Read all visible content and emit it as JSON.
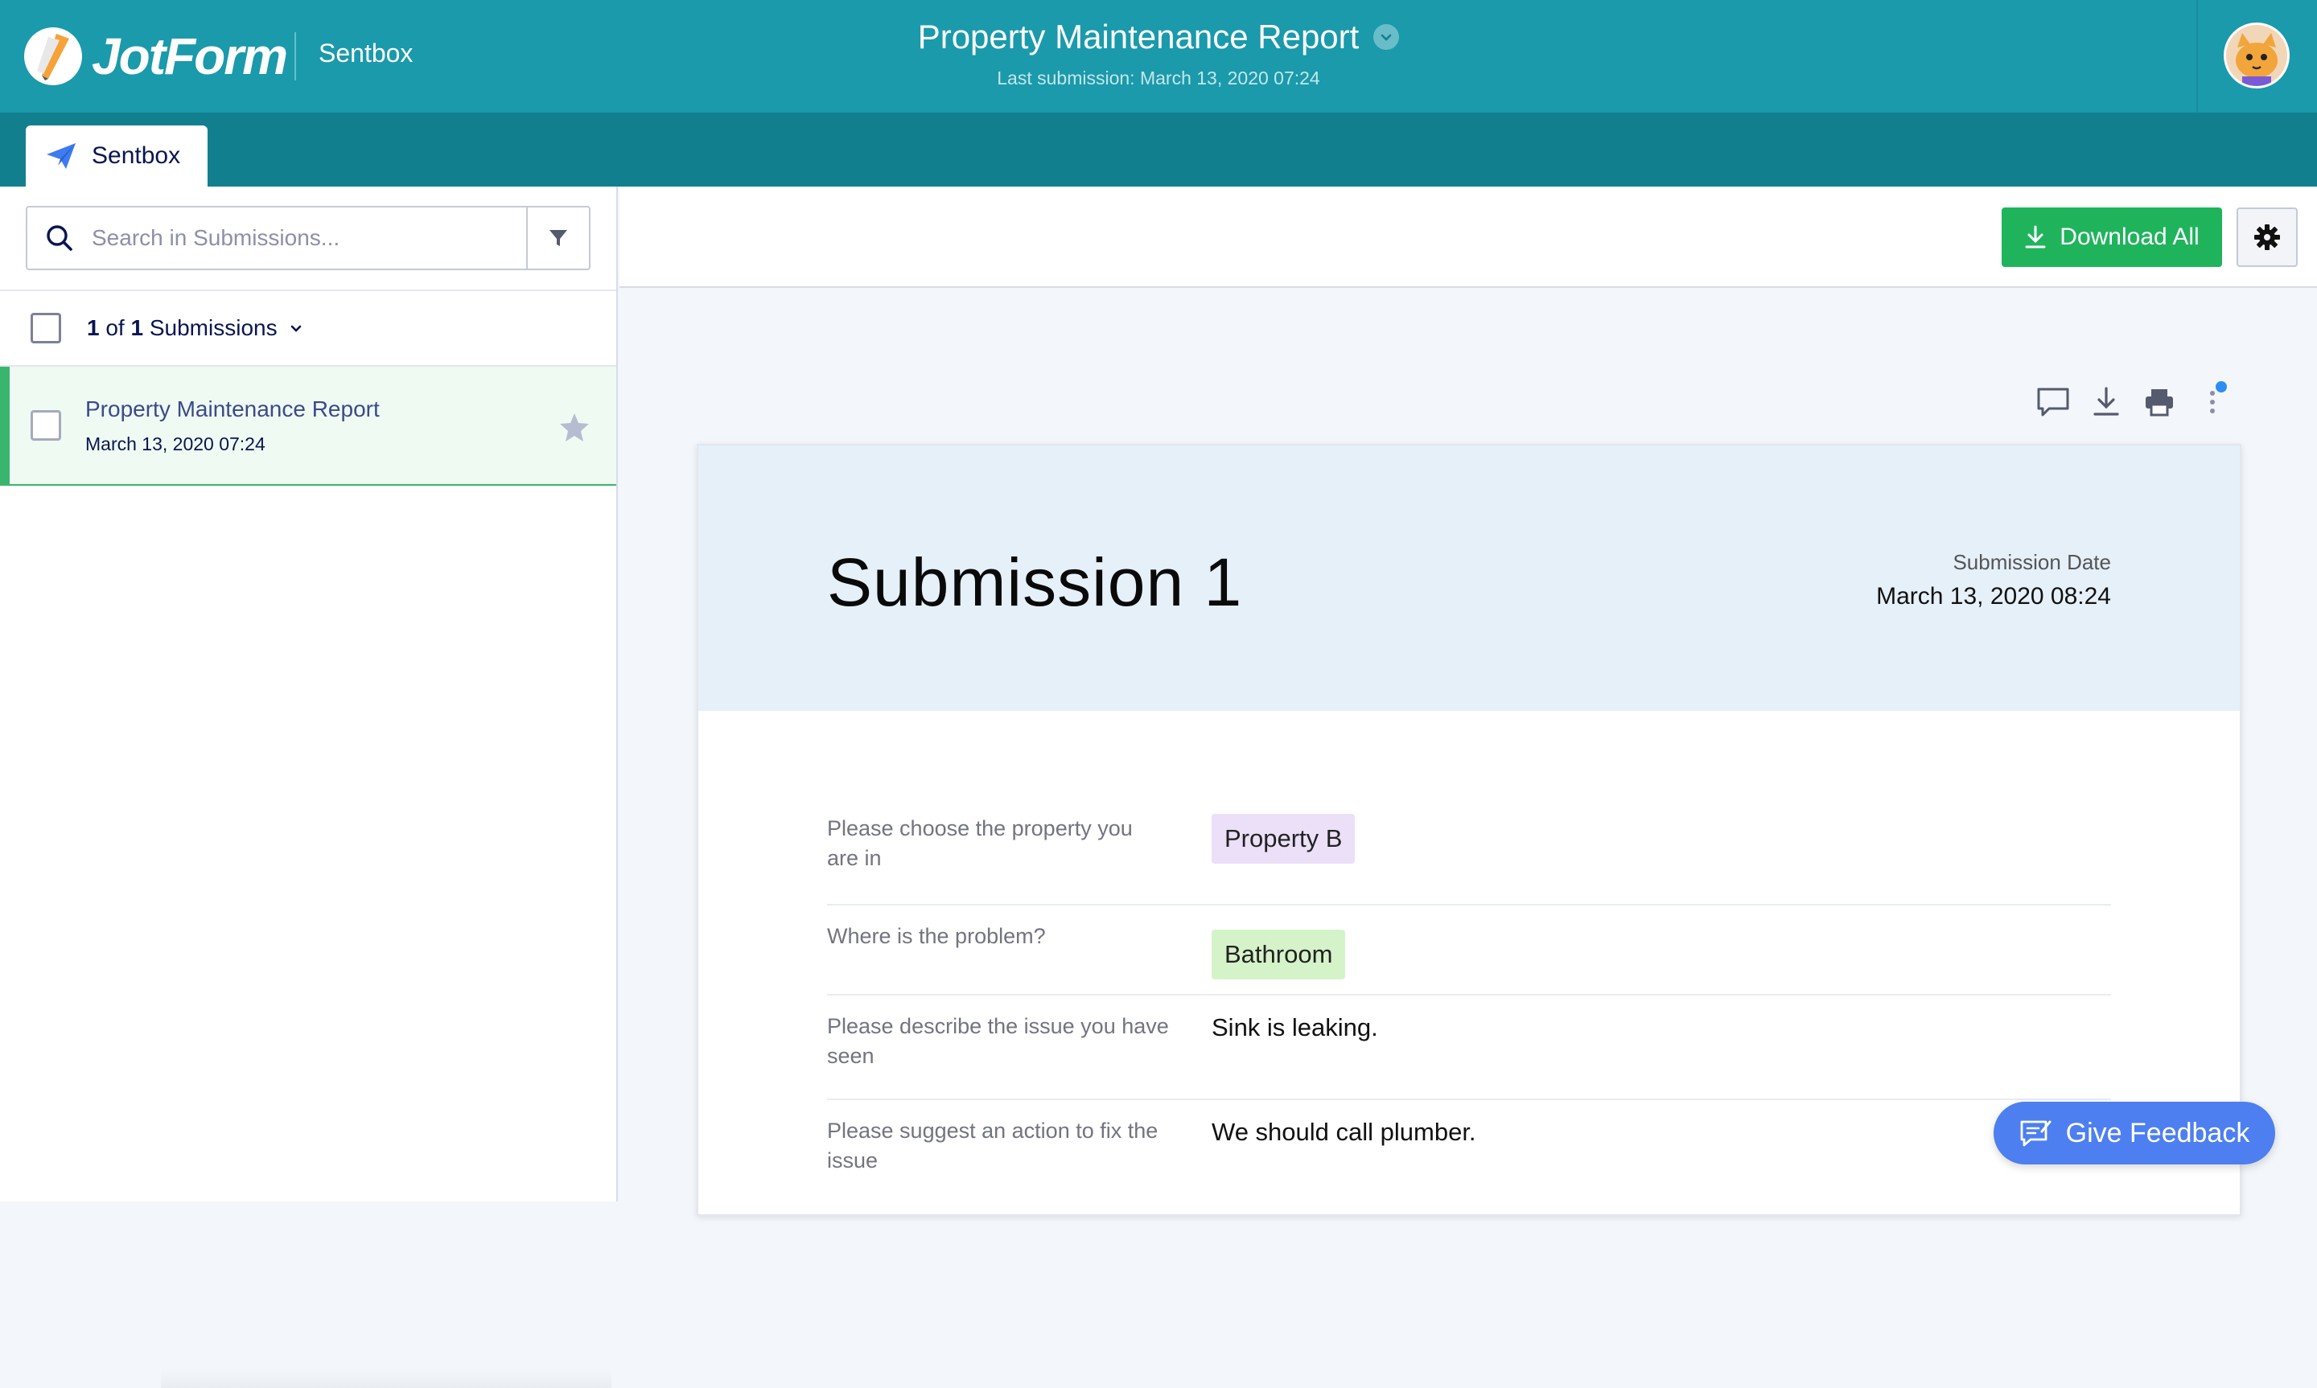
{
  "header": {
    "logo_text": "JotForm",
    "workspace": "Sentbox",
    "form_title": "Property Maintenance Report",
    "last_submission": "Last submission: March 13, 2020 07:24"
  },
  "tabs": [
    {
      "label": "Sentbox",
      "icon": "paper-plane-icon"
    }
  ],
  "sidebar": {
    "search_placeholder": "Search in Submissions...",
    "count_prefix": "1",
    "count_mid": " of ",
    "count_total": "1",
    "count_suffix": " Submissions",
    "submissions": [
      {
        "title": "Property Maintenance Report",
        "date": "March 13, 2020 07:24"
      }
    ]
  },
  "toolbar": {
    "download_all_label": "Download All"
  },
  "submission": {
    "title": "Submission 1",
    "date_label": "Submission Date",
    "date_value": "March 13, 2020 08:24",
    "fields": [
      {
        "question_line1": "Please choose the property you",
        "question_line2": "are in",
        "answer": "Property B"
      },
      {
        "question_line1": "Where is the problem?",
        "question_line2": "",
        "answer": "Bathroom"
      },
      {
        "question_line1": "Please describe the issue you have",
        "question_line2": "seen",
        "answer": "Sink is leaking."
      },
      {
        "question_line1": "Please suggest an action to fix the",
        "question_line2": "issue",
        "answer": "We should call plumber."
      }
    ]
  },
  "feedback": {
    "label": "Give Feedback"
  },
  "colors": {
    "header_bg": "#1a9aab",
    "tabbar_bg": "#127f8f",
    "download_green": "#1fb45c",
    "feedback_blue": "#4d7ff1",
    "selected_accent": "#3ab56e"
  }
}
